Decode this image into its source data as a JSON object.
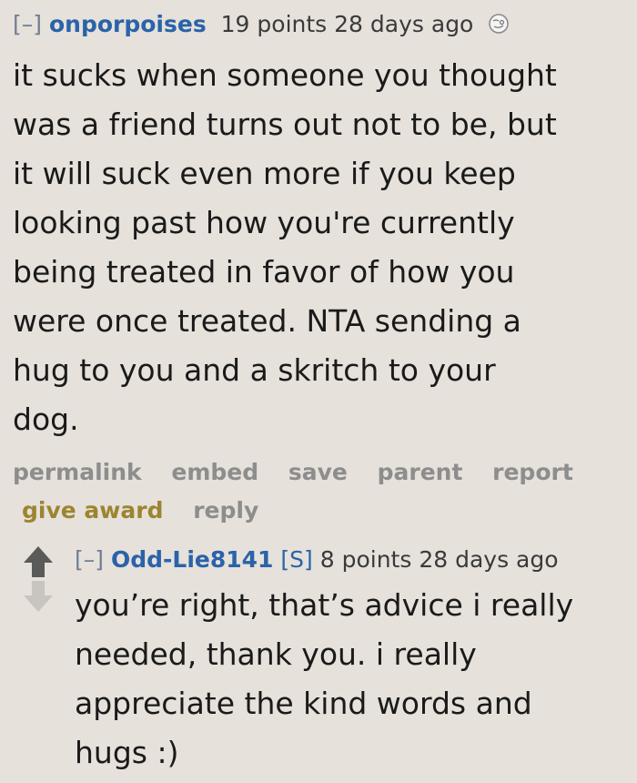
{
  "comments": [
    {
      "expand": "[–]",
      "author": "onporpoises",
      "score": "19 points",
      "time": "28 days ago",
      "flair_icon": "face-icon",
      "body": "it sucks when someone you thought\nwas a friend turns out not to be, but\nit will suck even more if you keep\nlooking past how you're currently\nbeing treated in favor of how you\nwere once treated. NTA sending a\nhug to you and a skritch to your\ndog.",
      "buttons": {
        "permalink": "permalink",
        "embed": "embed",
        "save": "save",
        "parent": "parent",
        "report": "report",
        "give_award": "give award",
        "reply": "reply"
      }
    },
    {
      "expand": "[–]",
      "author": "Odd-Lie8141",
      "submitter_tag": "[S]",
      "score": "8 points",
      "time": "28 days ago",
      "body": "you’re right, that’s advice i really\nneeded, thank you. i really\nappreciate the kind words and\nhugs :)",
      "vote_icons": [
        "upvote-arrow-icon",
        "downvote-arrow-icon"
      ]
    }
  ],
  "colors": {
    "background": "#e6e1db",
    "author": "#2a63a8",
    "button_text": "#8d8d8d",
    "award": "#9c8530"
  }
}
